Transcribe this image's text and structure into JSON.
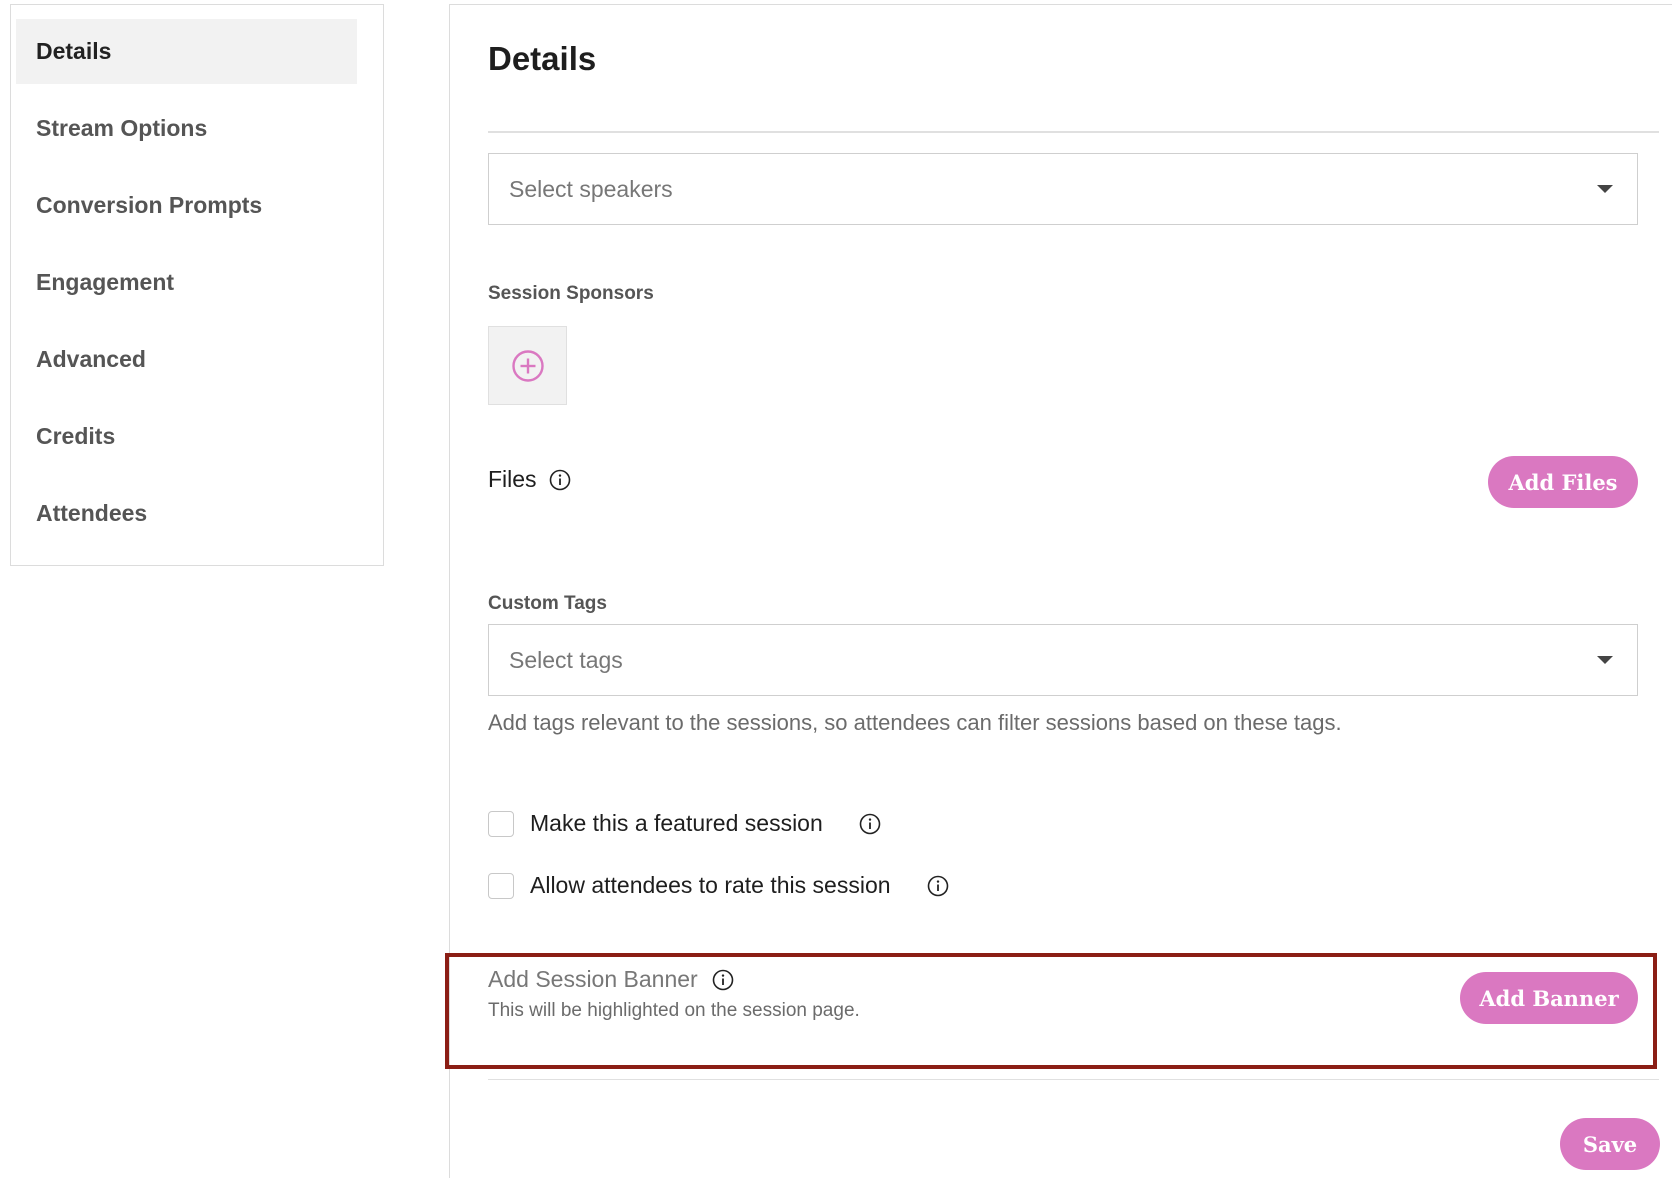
{
  "sidebar": {
    "items": [
      {
        "label": "Details",
        "active": true
      },
      {
        "label": "Stream Options"
      },
      {
        "label": "Conversion Prompts"
      },
      {
        "label": "Engagement"
      },
      {
        "label": "Advanced"
      },
      {
        "label": "Credits"
      },
      {
        "label": "Attendees"
      }
    ]
  },
  "main": {
    "title": "Details",
    "speakers": {
      "placeholder": "Select speakers"
    },
    "sponsors": {
      "label": "Session Sponsors"
    },
    "files": {
      "label": "Files",
      "button": "Add Files"
    },
    "tags": {
      "label": "Custom Tags",
      "placeholder": "Select tags",
      "help": "Add tags relevant to the sessions, so attendees can filter sessions based on these tags."
    },
    "checkboxes": [
      {
        "label": "Make this a featured session",
        "checked": false
      },
      {
        "label": "Allow attendees to rate this session",
        "checked": false
      }
    ],
    "banner": {
      "title": "Add Session Banner",
      "subtitle": "This will be highlighted on the session page.",
      "button": "Add Banner"
    },
    "save_label": "Save"
  },
  "colors": {
    "accent": "#da78c1",
    "highlight_border": "#8b1e15"
  }
}
